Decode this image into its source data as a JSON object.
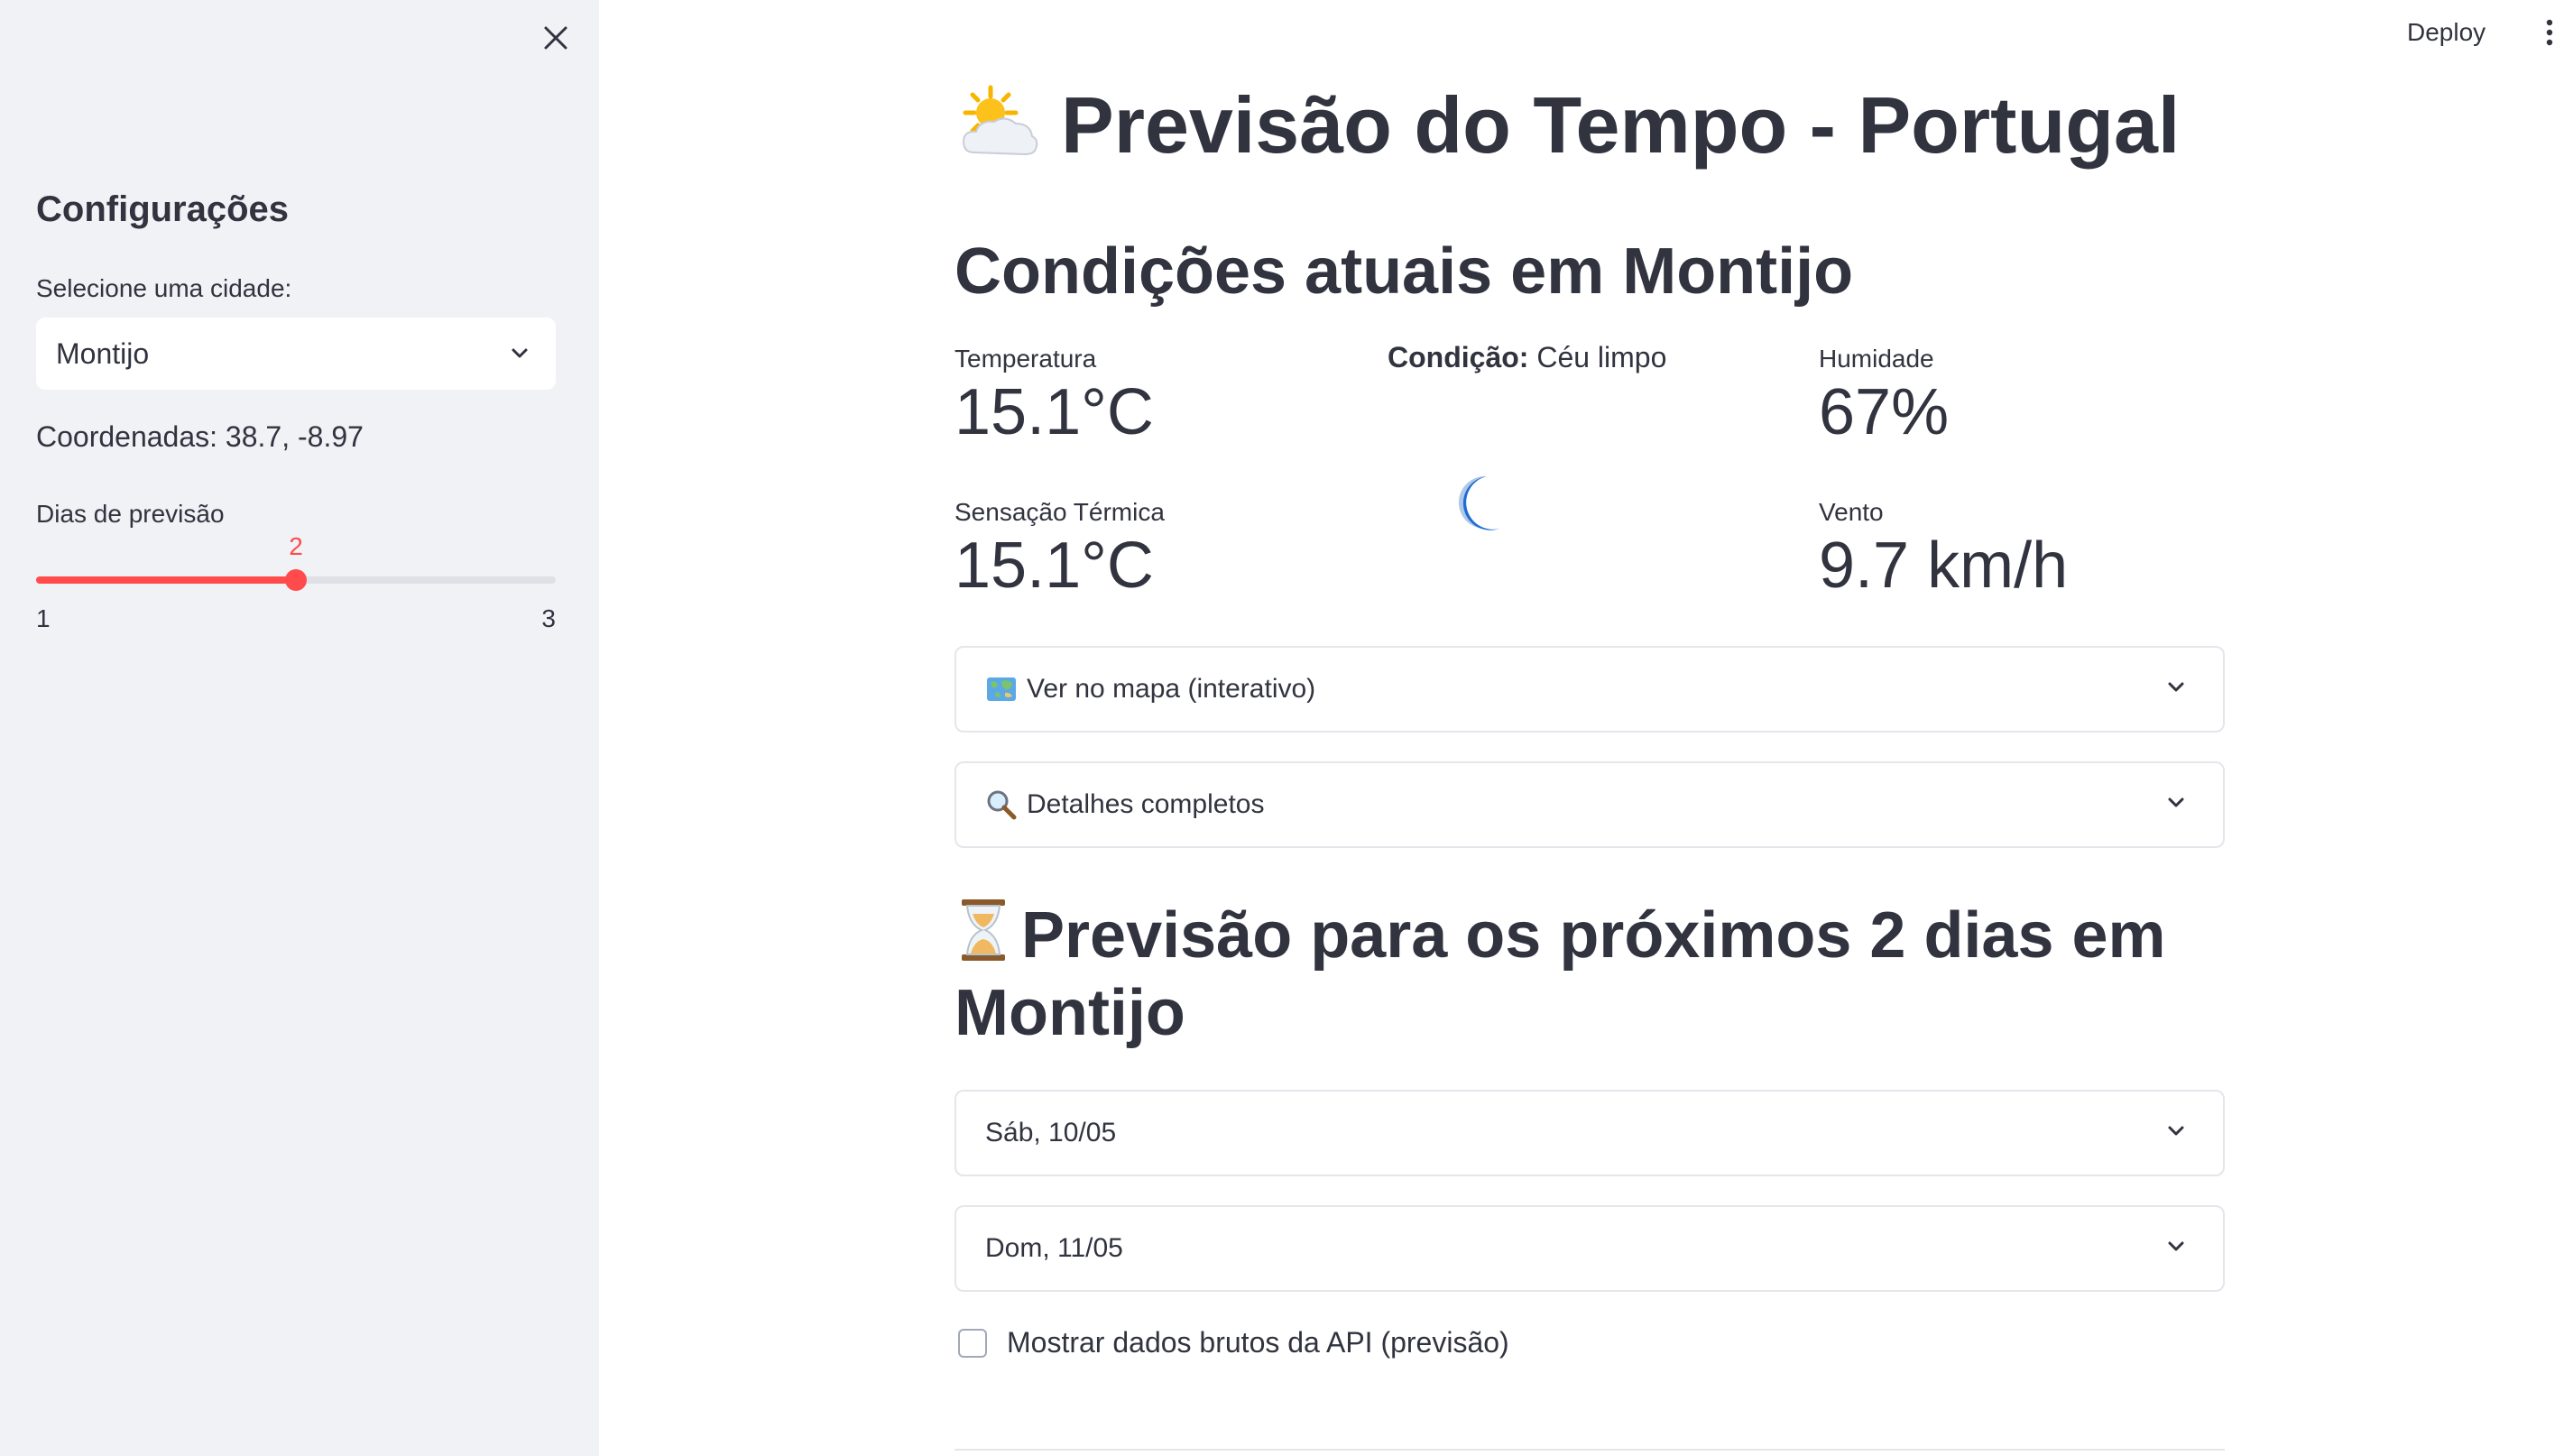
{
  "sidebar": {
    "close_label": "×",
    "heading": "Configurações",
    "city_select": {
      "label": "Selecione uma cidade:",
      "value": "Montijo"
    },
    "coordinates_text": "Coordenadas: 38.7, -8.97",
    "forecast_days_slider": {
      "label": "Dias de previsão",
      "value": 2,
      "min": 1,
      "max": 3,
      "accent_color": "#ff4b4b"
    }
  },
  "header": {
    "deploy_label": "Deploy",
    "menu_icon": "vertical-dots-icon"
  },
  "main": {
    "title": "Previsão do Tempo - Portugal",
    "title_icon": "sun-behind-cloud-icon",
    "current": {
      "heading": "Condições atuais em Montijo",
      "temperature": {
        "label": "Temperatura",
        "value": "15.1°C"
      },
      "feels_like": {
        "label": "Sensação Térmica",
        "value": "15.1°C"
      },
      "condition": {
        "label": "Condição:",
        "value": "Céu limpo",
        "icon": "crescent-moon-icon"
      },
      "humidity": {
        "label": "Humidade",
        "value": "67%"
      },
      "wind": {
        "label": "Vento",
        "value": "9.7 km/h"
      }
    },
    "expanders": {
      "map": {
        "label": "Ver no mapa (interativo)",
        "icon": "world-map-icon"
      },
      "details": {
        "label": "Detalhes completos",
        "icon": "magnifying-glass-icon"
      }
    },
    "forecast": {
      "heading": "Previsão para os próximos 2 dias em Montijo",
      "icon": "hourglass-icon",
      "days": [
        {
          "label": "Sáb, 10/05"
        },
        {
          "label": "Dom, 11/05"
        }
      ]
    },
    "raw_data_checkbox": {
      "label": "Mostrar dados brutos da API (previsão)",
      "checked": false
    }
  }
}
